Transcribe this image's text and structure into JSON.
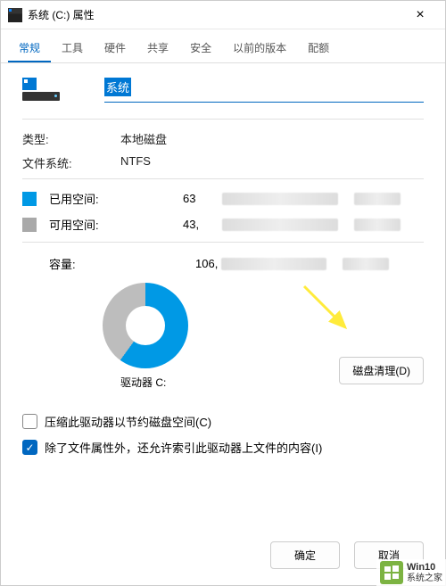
{
  "chart_data": {
    "type": "pie",
    "title": "驱动器 C:",
    "series": [
      {
        "name": "已用空间",
        "value": 63,
        "color": "#0099e5"
      },
      {
        "name": "可用空间",
        "value": 43,
        "color": "#bdbdbd"
      }
    ]
  },
  "window": {
    "title": "系统 (C:) 属性",
    "close": "×"
  },
  "tabs": [
    "常规",
    "工具",
    "硬件",
    "共享",
    "安全",
    "以前的版本",
    "配额"
  ],
  "active_tab_index": 0,
  "drive": {
    "name_value": "系统",
    "type_label": "类型:",
    "type_value": "本地磁盘",
    "fs_label": "文件系统:",
    "fs_value": "NTFS"
  },
  "space": {
    "used_label": "已用空间:",
    "used_value_prefix": "63",
    "free_label": "可用空间:",
    "free_value_prefix": "43,",
    "capacity_label": "容量:",
    "capacity_value_prefix": "106,"
  },
  "pie_label": "驱动器 C:",
  "cleanup_button": "磁盘清理(D)",
  "checkbox_compress": "压缩此驱动器以节约磁盘空间(C)",
  "checkbox_index": "除了文件属性外，还允许索引此驱动器上文件的内容(I)",
  "buttons": {
    "ok": "确定",
    "cancel": "取消"
  },
  "watermark": {
    "line1": "Win10",
    "line2": "系统之家"
  }
}
